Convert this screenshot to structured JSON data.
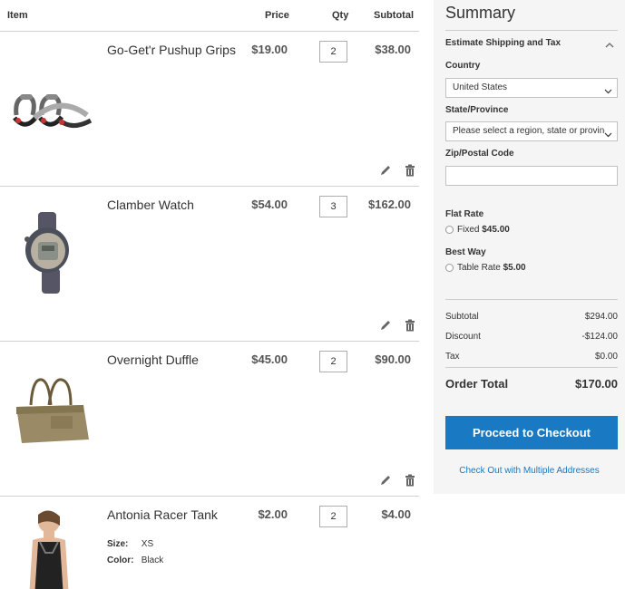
{
  "cart": {
    "headers": {
      "item": "Item",
      "price": "Price",
      "qty": "Qty",
      "subtotal": "Subtotal"
    },
    "items": [
      {
        "name": "Go-Get'r Pushup Grips",
        "price": "$19.00",
        "qty": "2",
        "subtotal": "$38.00",
        "image": "pushup-grips-image"
      },
      {
        "name": "Clamber Watch",
        "price": "$54.00",
        "qty": "3",
        "subtotal": "$162.00",
        "image": "watch-image"
      },
      {
        "name": "Overnight Duffle",
        "price": "$45.00",
        "qty": "2",
        "subtotal": "$90.00",
        "image": "duffle-bag-image"
      },
      {
        "name": "Antonia Racer Tank",
        "price": "$2.00",
        "qty": "2",
        "subtotal": "$4.00",
        "image": "tank-top-image",
        "options": [
          {
            "label": "Size:",
            "value": "XS"
          },
          {
            "label": "Color:",
            "value": "Black"
          }
        ]
      }
    ],
    "icons": {
      "edit": "pencil-icon",
      "delete": "trash-icon"
    }
  },
  "summary": {
    "title": "Summary",
    "estimate_label": "Estimate Shipping and Tax",
    "country_label": "Country",
    "country_value": "United States",
    "state_label": "State/Province",
    "state_value": "Please select a region, state or province.",
    "zip_label": "Zip/Postal Code",
    "zip_value": "",
    "flat_rate_title": "Flat Rate",
    "flat_rate_option": "Fixed",
    "flat_rate_price": "$45.00",
    "best_way_title": "Best Way",
    "best_way_option": "Table Rate",
    "best_way_price": "$5.00",
    "subtotal_label": "Subtotal",
    "subtotal_value": "$294.00",
    "discount_label": "Discount",
    "discount_value": "-$124.00",
    "tax_label": "Tax",
    "tax_value": "$0.00",
    "order_total_label": "Order Total",
    "order_total_value": "$170.00",
    "checkout_label": "Proceed to Checkout",
    "multi_label": "Check Out with Multiple Addresses"
  },
  "colors": {
    "accent": "#1979c3",
    "panel_bg": "#f5f5f5",
    "border": "#d1d1d1"
  }
}
